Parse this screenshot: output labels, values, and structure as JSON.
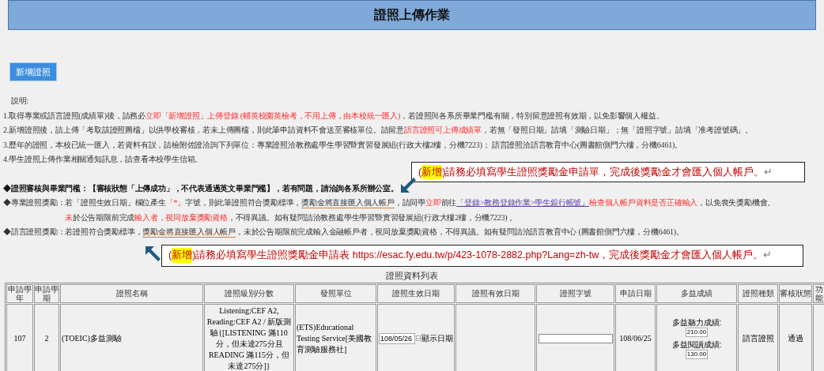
{
  "page": {
    "title": "證照上傳作業"
  },
  "toolbar": {
    "add_button": "新增證照"
  },
  "notes": {
    "heading": "說明:",
    "items": [
      [
        {
          "kind": "plain",
          "text": "1.取得專業或語言證照(成績單)後，請務必"
        },
        {
          "kind": "red",
          "text": "立即「新增證照」上傳登錄 (輔英校園英檢考，不用上傳，由本校統一匯入)"
        },
        {
          "kind": "plain",
          "text": "，若證照與各系所畢業門檻有關，特別留意證照有效期，以免影響個人權益。"
        }
      ],
      [
        {
          "kind": "plain",
          "text": "2.新增證照後，請上傳「考取該證照圖檔」以供學校審核，若未上傳圖檔，則此筆申請資料不會送至審核單位。請留意"
        },
        {
          "kind": "red",
          "text": "語言證照可上傳成績單"
        },
        {
          "kind": "plain",
          "text": "，若無「發照日期」請填「測驗日期」；無「證照字號」請填「准考證號碼」。"
        }
      ],
      [
        {
          "kind": "plain",
          "text": "3.歷年的證照，本校已統一匯入，若資料有誤，請檢附佐證洽詢下列單位：專業證照洽教務處學生學習暨實習發展組(行政大樓2樓，分機7223)； 語言證照洽語言教育中心(圖書館側門六樓，分機6461)。"
        }
      ],
      [
        {
          "kind": "plain",
          "text": "4.學生證照上傳作業相關通知訊息，請查看本校學生信箱。"
        }
      ]
    ]
  },
  "rules": [
    {
      "kind": "line",
      "segments": [
        {
          "kind": "bold",
          "text": "◆證照審核與畢業門檻：【審核狀態「上傳成功」，不代表通過英文畢業門檻】，若有問題，請洽詢各系所辦公室。"
        }
      ]
    },
    {
      "kind": "line",
      "segments": [
        {
          "kind": "plain",
          "text": "◆專業證照獎勵：若「證照生效日期」欄位產生"
        },
        {
          "kind": "red",
          "text": "「*」"
        },
        {
          "kind": "plain",
          "text": "字號，則此筆證照符合獎勵標準，"
        },
        {
          "kind": "strike",
          "text": "獎勵金將直接匯入個人帳戶"
        },
        {
          "kind": "plain",
          "text": "，請同學"
        },
        {
          "kind": "red",
          "text": "立即"
        },
        {
          "kind": "plain",
          "text": "前往"
        },
        {
          "kind": "link",
          "text": "「登錄>教務登錄作業>學生銀行帳號」"
        },
        {
          "kind": "red",
          "text": "檢查個人帳戶資料是否正確輸入"
        },
        {
          "kind": "plain",
          "text": "，以免喪失獎勵機會。"
        }
      ]
    },
    {
      "kind": "continuation",
      "segments": [
        {
          "kind": "red",
          "text": "未"
        },
        {
          "kind": "plain",
          "text": "於公告期限前完成"
        },
        {
          "kind": "red",
          "text": "輸入者，視同放棄獎勵資格"
        },
        {
          "kind": "plain",
          "text": "，不得異議。如有疑問請洽教務處學生學習暨實習發展組(行政大樓2樓，分機7223) 。"
        }
      ]
    },
    {
      "kind": "line",
      "segments": [
        {
          "kind": "plain",
          "text": "◆語言證照獎勵：若證照符合獎勵標準，"
        },
        {
          "kind": "strike",
          "text": "獎勵金將直接匯入個人帳戶"
        },
        {
          "kind": "plain",
          "text": "，未於公告期限前完成輸入金融帳戶者，視同放棄獎勵資格，不得異議。如有疑問請洽語言教育中心 (圖書館側門六樓，分機6461)。"
        }
      ]
    }
  ],
  "callouts": [
    [
      {
        "kind": "red",
        "text": "("
      },
      {
        "kind": "highlight",
        "text": "新增"
      },
      {
        "kind": "red",
        "text": ")請務必填寫學生證照獎勵金申請單，完成後獎勵金才會匯入個人帳戶。"
      },
      {
        "kind": "mark",
        "text": "↵"
      }
    ],
    [
      {
        "kind": "red",
        "text": "("
      },
      {
        "kind": "highlight",
        "text": "新增"
      },
      {
        "kind": "red",
        "text": ")請務必填寫學生證照獎勵金申請表 https://esac.fy.edu.tw/p/423-1078-2882.php?Lang=zh-tw，完成後獎勵金才會匯入個人帳戶。"
      },
      {
        "kind": "mark",
        "text": "↵"
      }
    ]
  ],
  "table": {
    "caption": "證照資料列表",
    "columns": [
      "申請學年",
      "申請學期",
      "證照名稱",
      "證照級別/分數",
      "發照單位",
      "證照生效日期",
      "證照有效日期",
      "證照字號",
      "申請日期",
      "多益成績",
      "證照種類",
      "審核狀態",
      "功能"
    ],
    "rows": [
      [
        {
          "kind": "text",
          "text": "107"
        },
        {
          "kind": "text",
          "text": "2"
        },
        {
          "kind": "left",
          "text": "(TOEIC)多益測驗"
        },
        {
          "kind": "text",
          "text": "Listening:CEF A2, Reading:CEF A2 / 新版測驗{[LISTENING 滿110分，但未達275分且READING 滿115分，但未達275分]}"
        },
        {
          "kind": "left",
          "text": "(ETS)Educational Testing Service[美國教育測驗服務社]"
        },
        {
          "kind": "date_input",
          "value": "108/05/26",
          "image_alt": "顯示日期"
        },
        {
          "kind": "empty"
        },
        {
          "kind": "input"
        },
        {
          "kind": "text",
          "text": "108/06/25"
        },
        {
          "kind": "scores",
          "items": [
            {
              "label": "多益聽力成績:",
              "value": "210.00"
            },
            {
              "label": "多益閱讀成績:",
              "value": "130.00"
            }
          ]
        },
        {
          "kind": "sans",
          "text": "語言證照"
        },
        {
          "kind": "sans",
          "text": "通過"
        },
        {
          "kind": "empty"
        }
      ]
    ]
  }
}
